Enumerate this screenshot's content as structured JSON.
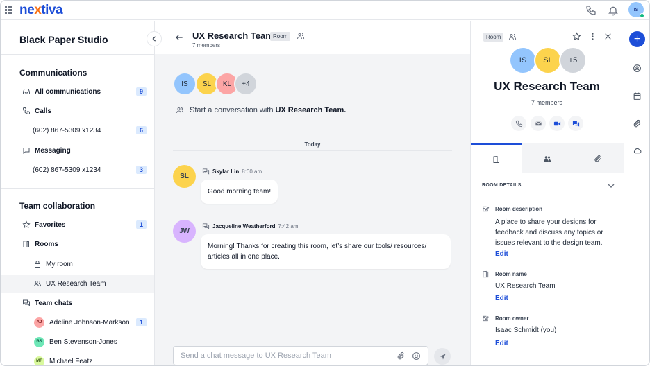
{
  "topbar": {
    "logo_pre": "ne",
    "logo_x": "x",
    "logo_post": "tiva",
    "user_initials": "IS"
  },
  "sidebar": {
    "org_name": "Black Paper Studio",
    "communications": {
      "heading": "Communications",
      "all": {
        "label": "All communications",
        "count": "9"
      },
      "calls": {
        "label": "Calls"
      },
      "calls_line": {
        "label": "(602) 867-5309 x1234",
        "count": "6"
      },
      "messaging": {
        "label": "Messaging"
      },
      "messaging_line": {
        "label": "(602) 867-5309 x1234",
        "count": "3"
      }
    },
    "team": {
      "heading": "Team collaboration",
      "favorites": {
        "label": "Favorites",
        "count": "1"
      },
      "rooms": {
        "label": "Rooms"
      },
      "my_room": {
        "label": "My room"
      },
      "ux_room": {
        "label": "UX Research Team"
      },
      "team_chats": {
        "label": "Team chats"
      },
      "chats": [
        {
          "initials": "AJ",
          "name": "Adeline Johnson-Markson",
          "count": "1",
          "color": "#fca5a5"
        },
        {
          "initials": "BS",
          "name": "Ben Stevenson-Jones",
          "color": "#6ee7b7"
        },
        {
          "initials": "MF",
          "name": "Michael Featz",
          "color": "#d9f99d"
        }
      ]
    }
  },
  "chat": {
    "title": "UX Research Team",
    "tag": "Room",
    "members": "7 members",
    "avatars": [
      {
        "initials": "IS",
        "color": "#93c5fd"
      },
      {
        "initials": "SL",
        "color": "#fcd34d"
      },
      {
        "initials": "KL",
        "color": "#fca5a5"
      },
      {
        "initials": "+4",
        "color": "#d1d5db"
      }
    ],
    "start_prefix": "Start a conversation with",
    "start_room": "UX Research Team.",
    "day": "Today",
    "messages": [
      {
        "initials": "SL",
        "color": "#fcd34d",
        "name": "Skylar Lin",
        "time": "8:00 am",
        "text": "Good morning team!"
      },
      {
        "initials": "JW",
        "color": "#d8b4fe",
        "name": "Jacqueline Weatherford",
        "time": "7:42 am",
        "text": "Morning! Thanks for creating this room, let’s share our tools/ resources/ articles all in one place."
      }
    ],
    "composer_placeholder": "Send a chat message to UX Research Team"
  },
  "details": {
    "tag": "Room",
    "avatars": [
      {
        "initials": "IS",
        "color": "#93c5fd"
      },
      {
        "initials": "SL",
        "color": "#fcd34d"
      },
      {
        "initials": "+5",
        "color": "#d1d5db"
      }
    ],
    "title": "UX Research Team",
    "members": "7 members",
    "section": "ROOM DETAILS",
    "description_label": "Room description",
    "description": "A place to share your designs for feedback and discuss any topics or issues relevant to the design team.",
    "name_label": "Room name",
    "name": "UX Research Team",
    "owner_label": "Room owner",
    "owner": "Isaac Schmidt (you)",
    "edit": "Edit"
  },
  "colors": {
    "brand_blue": "#1d4ed8",
    "logo_accent": "#f97316"
  }
}
